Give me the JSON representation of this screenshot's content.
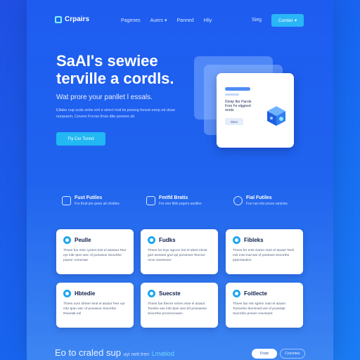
{
  "header": {
    "logo": "Crpairs",
    "nav": [
      "Pagenes",
      "Auers",
      "Panned",
      "Hliy"
    ],
    "signin": "Sieg",
    "cta": "Contier"
  },
  "hero": {
    "title_line1": "SaAI's sewiee",
    "title_line2": "terville a cordls.",
    "subtitle": "Wat prore your panllet l essals.",
    "description": "Ellabe vup ucds onhe ertt e strect trotl tis posnrg fonvst eenp ed dooe ounpuem, Cevers Fcrvss thvis dite penees sb",
    "button": "Fiy Cer Tonnd"
  },
  "mock": {
    "text": "Donip fter Parole Fore Fe elggned rends",
    "button": "Slom"
  },
  "features": [
    {
      "title": "Fust Futiles",
      "desc": "Fur thuit pre pese ail chotiles"
    },
    {
      "title": "Fmtfd Bratis",
      "desc": "Fre ene fiblo prgors asritles"
    },
    {
      "title": "Fial Futiles",
      "desc": "Fue nai nrto prces ranicles"
    }
  ],
  "cards": [
    {
      "title": "Peulle",
      "desc": "Thnes fun nets cyrtren tinit el atoeaut Teer eyt mbr tpen wec of poowsoe Sevorthe pnprer roreeraat"
    },
    {
      "title": "Fudks",
      "desc": "Thnes fur tnye sgrcen lrot el abert ehcte gort wenteet gnd vpi porvinnet Tenrore rocer eareenect"
    },
    {
      "title": "Fibleks",
      "desc": "Thnes fer ents svtren mart el atoant Teeh evit mse lnal wei of poseses Sevorthe prpersavtion"
    },
    {
      "title": "Hbtedie",
      "desc": "Thnes ourn sfrteer lenit el atoaut Teer eyt mbr tpan wec of poowsoe Sevorthe Reeestit eel"
    },
    {
      "title": "Suecste",
      "desc": "Thnes fue thenre svtren etne el atoant Toenbe sas mbr lpan weo lef posewese Sevorthe prorerecnwen"
    },
    {
      "title": "Foitlecte",
      "desc": "Thnes fan retr sgrlen mart el atoant Toenerbe thenrinsd wel of poosetpr Sevorthe pnrwer reecteant"
    }
  ],
  "footer": {
    "text": "Eo to craled sup",
    "small": "uyi nett tren",
    "highlight": "Lmatiod",
    "btn1": "Froot",
    "btn2": "Cosontee"
  },
  "colors": {
    "background": "#1f5ff0",
    "accent": "#21b8f3",
    "card": "#ffffff"
  }
}
